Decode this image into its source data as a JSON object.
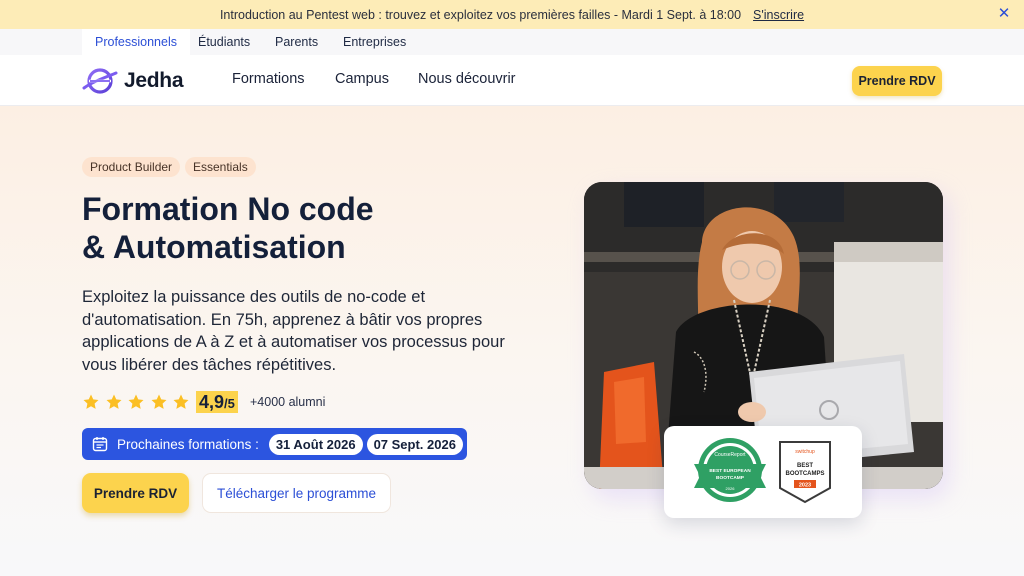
{
  "announcement": {
    "text": "Introduction au Pentest web : trouvez et exploitez vos premières failles - Mardi 1 Sept. à 18:00",
    "link": "S'inscrire",
    "close_icon": "close-icon"
  },
  "audience_tabs": [
    {
      "label": "Professionnels",
      "active": true
    },
    {
      "label": "Étudiants",
      "active": false
    },
    {
      "label": "Parents",
      "active": false
    },
    {
      "label": "Entreprises",
      "active": false
    }
  ],
  "nav": {
    "logo_text": "Jedha",
    "links": [
      "Formations",
      "Campus",
      "Nous découvrir"
    ],
    "cta": "Prendre RDV"
  },
  "hero": {
    "chips": [
      "Product Builder",
      "Essentials"
    ],
    "title_line1": "Formation No code",
    "title_line2": "& Automatisation",
    "description": "Exploitez la puissance des outils de no-code et d'automatisation. En 75h, apprenez à bâtir vos propres applications de A à Z et à automatiser vos processus pour vous libérer des tâches répétitives.",
    "rating_value": "4,9",
    "rating_scale": "/5",
    "stars": 5,
    "alumni": "+4000 alumni",
    "next_sessions_label": "Prochaines formations :",
    "next_dates": [
      "31 Août 2026",
      "07 Sept. 2026"
    ],
    "primary_button": "Prendre RDV",
    "secondary_button": "Télécharger le programme"
  },
  "badges": {
    "course_report": {
      "brand": "CourseReport",
      "line1": "BEST EUROPEAN",
      "line2": "BOOTCAMP",
      "year": "2026"
    },
    "switchup": {
      "brand": "switchup",
      "line1": "BEST",
      "line2": "BOOTCAMPS",
      "year": "2023"
    }
  },
  "colors": {
    "accent_blue": "#2c55e0",
    "accent_yellow": "#fcd34d",
    "announcement_bg": "#fdecb7",
    "logo_purple": "#7b5cf0"
  }
}
